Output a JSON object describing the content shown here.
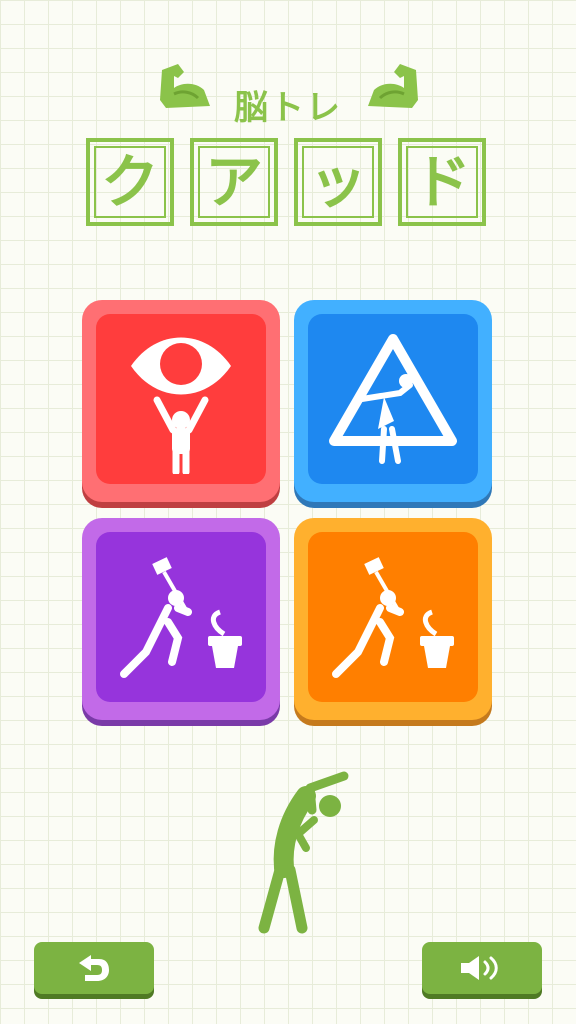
{
  "header": {
    "subtitle": "脳トレ",
    "title_chars": [
      "ク",
      "ア",
      "ッ",
      "ド"
    ]
  },
  "modes": [
    {
      "name": "eye-mode",
      "color": "#ff3d3d",
      "frame": "#ff6f73",
      "shadow": "#bf3f41",
      "icon": "eye-person-icon"
    },
    {
      "name": "warning-mode",
      "color": "#1e88f0",
      "frame": "#42b0ff",
      "shadow": "#2f78b8",
      "icon": "warning-sign-icon"
    },
    {
      "name": "purple-hammer-mode",
      "color": "#9634dc",
      "frame": "#c26ae8",
      "shadow": "#7a3aa8",
      "icon": "hammer-mortar-icon"
    },
    {
      "name": "orange-hammer-mode",
      "color": "#ff7f00",
      "frame": "#ffb02e",
      "shadow": "#c57a1d",
      "icon": "hammer-mortar-icon"
    }
  ],
  "mascot": {
    "icon": "stretching-person-icon",
    "color": "#7cb342"
  },
  "buttons": {
    "back": {
      "icon": "back-arrow-icon"
    },
    "sound": {
      "icon": "speaker-icon"
    }
  },
  "theme": {
    "accent": "#8bc34a",
    "button": "#7cb342"
  }
}
